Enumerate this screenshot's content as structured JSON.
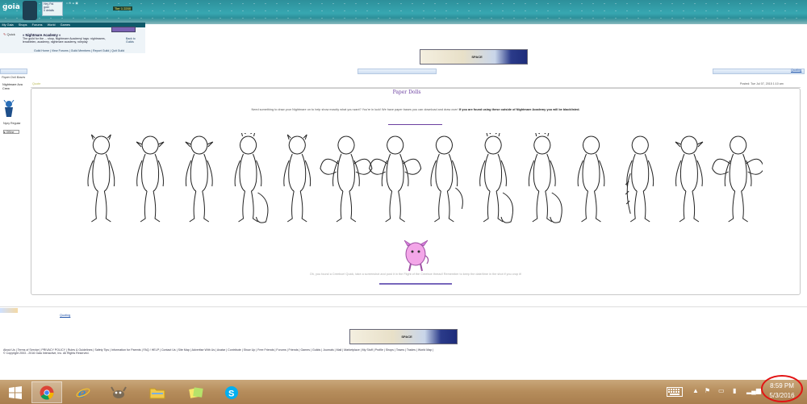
{
  "header": {
    "logo_text": "goia",
    "user_lines": [
      "Hey Pal",
      "gold",
      "0 details"
    ],
    "toplinks": "⌂ ✉ ☺ ▣",
    "gold_text": "Tier 1  2200"
  },
  "nav": {
    "items": [
      "My Gaia",
      "Shops",
      "Forums",
      "World",
      "Games"
    ]
  },
  "guild": {
    "quick_label": "Quick",
    "title": "» Nightmare Academy «",
    "description": "The guild for the ... shop, Nightmare Academy! tags: nightmares, lenablelen, academy, nightmare academy, roleplay",
    "links": "Guild Home | View Forums | Guild Members | Report Guild | Quit Guild",
    "side_links": [
      "Back to",
      "Guilds"
    ]
  },
  "breadcrumb": "Paper Doll Bases",
  "post": {
    "author_name": "Nightmare Ava Crew",
    "author_rank": "Nyxy Regular",
    "author_button": "▸ Offline",
    "quote_small": "Quote",
    "posted": "Posted: Tue Jul 07, 2015 1:10 am",
    "title": "Paper Dolls",
    "intro_plain": "Need something to draw your Nightmare on to help show exactly what you want? You're in luck! We have paper bases you can download and draw over!",
    "intro_bold": "If you are found using these outside of Nightmare Academy you will be blacklisted.",
    "outro": "Oh, you found a Creeboe! Quick, take a screenshot and post it in the Flight of the Creeboe thread! Remember to keep the date/time in the shot if you crop it!"
  },
  "quoting_label": "Quoting",
  "ad_text": "SPACE",
  "footer_links": "About Us | Terms of Service | PRIVACY POLICY | Rules & Guidelines | Safety Tips | Information for Parents | FAQ / HELP | Contact Us | Site Map | Advertise With Us | Avatar | Contribute | Show Up | Free Friends | Forums | Friends | Games | Guilds | Journals | Mail | Marketplace | My Stuff | Profile | Shops | Towns | Trades | World Map |",
  "copyright": "© Copyright 2003 - 2016 Gaia Interactive, Inc. All Rights Reserved.",
  "taskbar": {
    "apps": [
      "windows-start",
      "chrome",
      "internet-explorer",
      "gimp",
      "file-explorer",
      "notes",
      "skype"
    ],
    "time": "8:59 PM",
    "date": "5/3/2016"
  }
}
